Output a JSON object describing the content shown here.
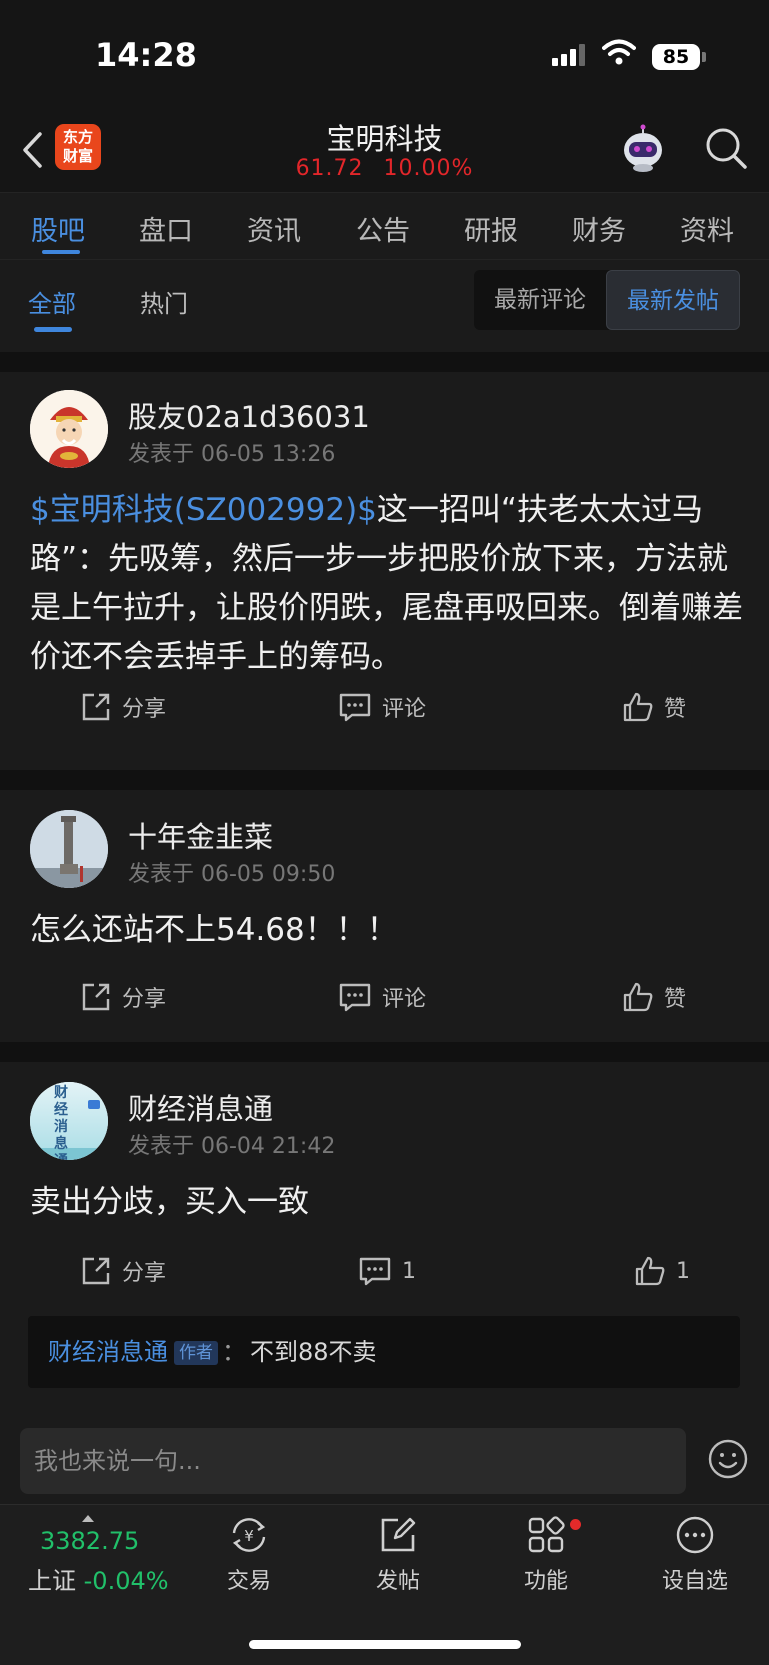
{
  "status_bar": {
    "time": "14:28",
    "battery": "85"
  },
  "header": {
    "logo_line1": "东方",
    "logo_line2": "财富",
    "title": "宝明科技",
    "price": "61.72",
    "change_pct": "10.00%"
  },
  "tabs": [
    "股吧",
    "盘口",
    "资讯",
    "公告",
    "研报",
    "财务",
    "资料"
  ],
  "subtabs": {
    "all": "全部",
    "hot": "热门",
    "sort_latest_comment": "最新评论",
    "sort_latest_post": "最新发帖"
  },
  "posts": [
    {
      "author": "股友02a1d36031",
      "time": "发表于 06-05 13:26",
      "tag": "$宝明科技(SZ002992)$",
      "text": "这一招叫“扶老太太过马路”：先吸筹，然后一步一步把股价放下来，方法就是上午拉升，让股价阴跌，尾盘再吸回来。倒着赚差价还不会丢掉手上的筹码。",
      "share": "分享",
      "comment": "评论",
      "like": "赞"
    },
    {
      "author": "十年金韭菜",
      "time": "发表于 06-05 09:50",
      "text": "怎么还站不上54.68！！！",
      "share": "分享",
      "comment": "评论",
      "like": "赞"
    },
    {
      "author": "财经消息通",
      "avatar_text": "财经消息通",
      "time": "发表于 06-04 21:42",
      "text": "卖出分歧，买入一致",
      "share": "分享",
      "comment": "1",
      "like": "1",
      "reply": {
        "name": "财经消息通",
        "badge": "作者",
        "sep": "：",
        "text": "不到88不卖"
      }
    }
  ],
  "comment_input": {
    "placeholder": "我也来说一句..."
  },
  "bottom_nav": {
    "index_value": "3382.75",
    "index_name": "上证",
    "index_change": "-0.04%",
    "trade": "交易",
    "post": "发帖",
    "functions": "功能",
    "watchlist": "设自选"
  },
  "colors": {
    "accent": "#4a8fe0",
    "up_red": "#e2262a",
    "down_green": "#21c06a"
  }
}
